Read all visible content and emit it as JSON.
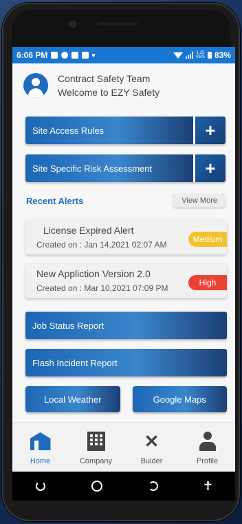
{
  "status_bar": {
    "time": "6:06 PM",
    "speed_value": "1.25",
    "speed_unit": "KB/s",
    "battery": "83%"
  },
  "header": {
    "team_name": "Contract Safety Team",
    "welcome": "Welcome to EZY Safety"
  },
  "menu": {
    "site_access_rules": "Site Access Rules",
    "site_risk_assessment": "Site Specific Risk Assessment",
    "plus_label": "+"
  },
  "alerts": {
    "title": "Recent Alerts",
    "view_more": "View More",
    "items": [
      {
        "title": "License Expired Alert",
        "date": "Created on : Jan 14,2021 02:07 AM",
        "severity": "Medium",
        "color": "#f2c12e"
      },
      {
        "title": "New Appliction Version 2.0",
        "date": "Created on : Mar 10,2021 07:09 PM",
        "severity": "High",
        "color": "#ea4335"
      }
    ]
  },
  "reports": {
    "job_status": "Job Status Report",
    "flash_incident": "Flash Incident Report",
    "local_weather": "Local Weather",
    "google_maps": "Google Maps"
  },
  "bottom_nav": {
    "home": "Home",
    "company": "Company",
    "builder": "Buider",
    "profile": "Profile"
  },
  "colors": {
    "accent": "#1e6bbf",
    "status_bar": "#1976d2"
  }
}
